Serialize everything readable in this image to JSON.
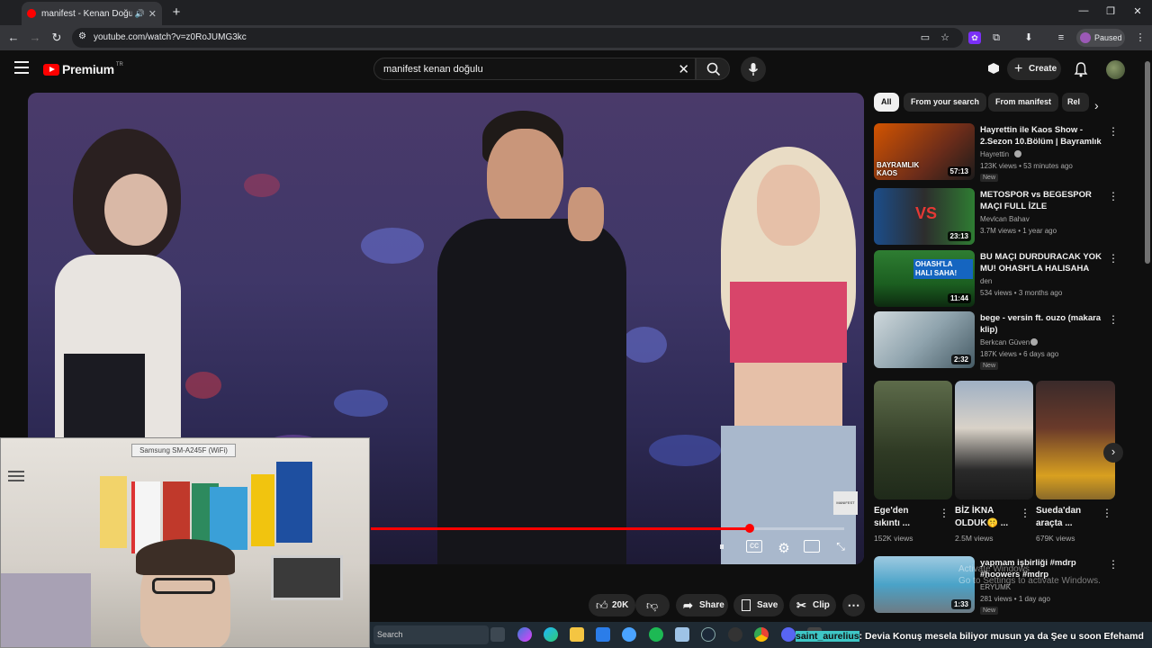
{
  "browser": {
    "tab_title": "manifest - Kenan Doğulu K",
    "url": "youtube.com/watch?v=z0RoJUMG3kc",
    "paused_label": "Paused"
  },
  "header": {
    "logo_text": "Premium",
    "logo_sup": "TR",
    "search_value": "manifest kenan doğulu",
    "create_label": "Create"
  },
  "video": {
    "progress_fraction": 0.8,
    "watermark": "MANIFEST"
  },
  "webcam": {
    "device_label": "Samsung SM-A245F (WiFi)"
  },
  "actions": {
    "like_count": "20K",
    "share_label": "Share",
    "save_label": "Save",
    "clip_label": "Clip"
  },
  "chips": [
    {
      "label": "All"
    },
    {
      "label": "From your search"
    },
    {
      "label": "From manifest"
    },
    {
      "label": "Rel"
    }
  ],
  "recommendations": [
    {
      "title": "Hayrettin ile Kaos Show - 2.Sezon 10.Bölüm | Bayramlık ...",
      "channel": "Hayrettin",
      "meta": "123K views • 53 minutes ago",
      "badge": "New",
      "duration": "57:13",
      "thumb_label": "BAYRAMLIK KAOS"
    },
    {
      "title": "METOSPOR vs BEGESPOR MAÇI FULL İZLE",
      "channel": "Mevlcan Bahav",
      "meta": "3.7M views • 1 year ago",
      "badge": "",
      "duration": "23:13",
      "thumb_label": "VS"
    },
    {
      "title": "BU MAÇI DURDURACAK YOK MU! OHASH'LA HALISAHA",
      "channel": "den",
      "meta": "534 views • 3 months ago",
      "badge": "",
      "duration": "11:44",
      "thumb_label": "OHASH'LA HALI SAHA!"
    },
    {
      "title": "bege - versin ft. ouzo (makara klip)",
      "channel": "Berkcan Güven",
      "meta": "187K views • 6 days ago",
      "badge": "New",
      "duration": "2:32",
      "thumb_label": ""
    },
    {
      "title": "yapmam işbirliği #mdrp #hoowers #mdrp",
      "channel": "ERYUMK",
      "meta": "281 views • 1 day ago",
      "badge": "New",
      "duration": "1:33",
      "thumb_label": ""
    }
  ],
  "shorts": [
    {
      "title_line1": "Ege'den",
      "title_line2": "sıkıntı ...",
      "views": "152K views"
    },
    {
      "title_line1": "BİZ İKNA",
      "title_line2": "OLDUK🤫 ...",
      "views": "2.5M views"
    },
    {
      "title_line1": "Sueda'dan",
      "title_line2": "araçta ...",
      "views": "679K views"
    }
  ],
  "activate_windows": {
    "line1": "Activate Windows",
    "line2": "Go to Settings to activate Windows."
  },
  "taskbar": {
    "search_placeholder": "Search"
  },
  "chat": {
    "user": "saint_aurelius",
    "message": ": Devia Konuş mesela biliyor musun ya da Şee u soon Efehamd"
  },
  "colors": {
    "accent": "#ff0000",
    "background": "#0f0f0f"
  }
}
